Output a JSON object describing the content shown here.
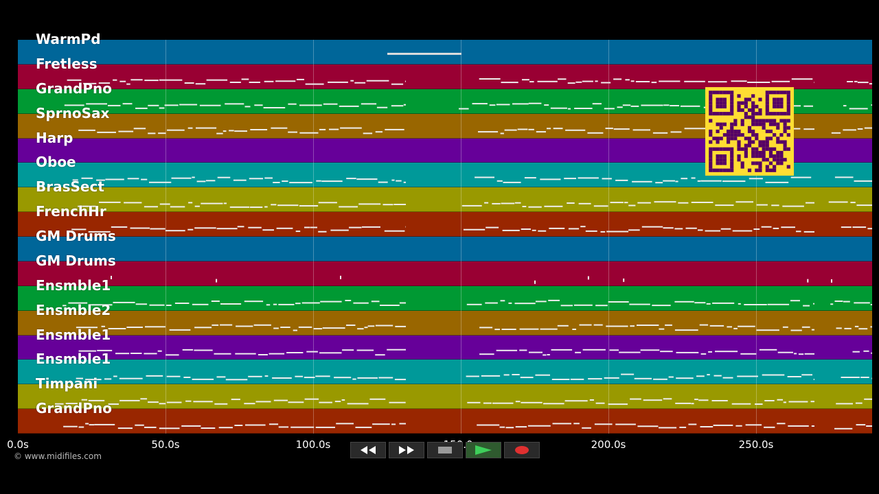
{
  "app": {
    "copyright": "© www.midifiles.com"
  },
  "tracks": [
    {
      "name": "WarmPd",
      "color": "#006699"
    },
    {
      "name": "Fretless",
      "color": "#990033"
    },
    {
      "name": "GrandPno",
      "color": "#009933"
    },
    {
      "name": "SprnoSax",
      "color": "#996600"
    },
    {
      "name": "Harp",
      "color": "#660099"
    },
    {
      "name": "Oboe",
      "color": "#009999"
    },
    {
      "name": "BrasSect",
      "color": "#999900"
    },
    {
      "name": "FrenchHr",
      "color": "#992600"
    },
    {
      "name": "GM Drums",
      "color": "#006699"
    },
    {
      "name": "GM Drums",
      "color": "#990033"
    },
    {
      "name": "Ensmble1",
      "color": "#009933"
    },
    {
      "name": "Ensmble2",
      "color": "#996600"
    },
    {
      "name": "Ensmble1",
      "color": "#660099"
    },
    {
      "name": "Ensmble1",
      "color": "#009999"
    },
    {
      "name": "Timpani",
      "color": "#999900"
    },
    {
      "name": "GrandPno",
      "color": "#992600"
    }
  ],
  "timeline": {
    "ticks": [
      "0.0s",
      "50.0s",
      "100.0s",
      "150.0s",
      "200.0s",
      "250.0s"
    ],
    "tick_values": [
      0,
      50,
      100,
      150,
      200,
      250
    ],
    "max_seconds": 289
  },
  "transport": {
    "buttons": [
      {
        "name": "rewind-button",
        "icon": "rewind-icon"
      },
      {
        "name": "fast-forward-button",
        "icon": "fast-forward-icon"
      },
      {
        "name": "stop-button",
        "icon": "stop-icon"
      },
      {
        "name": "play-button",
        "icon": "play-icon"
      },
      {
        "name": "record-button",
        "icon": "record-icon"
      }
    ]
  },
  "colors": {
    "background": "#000000",
    "qr_background": "#ffdd33",
    "qr_foreground": "#550066",
    "note": "#ffffff"
  }
}
